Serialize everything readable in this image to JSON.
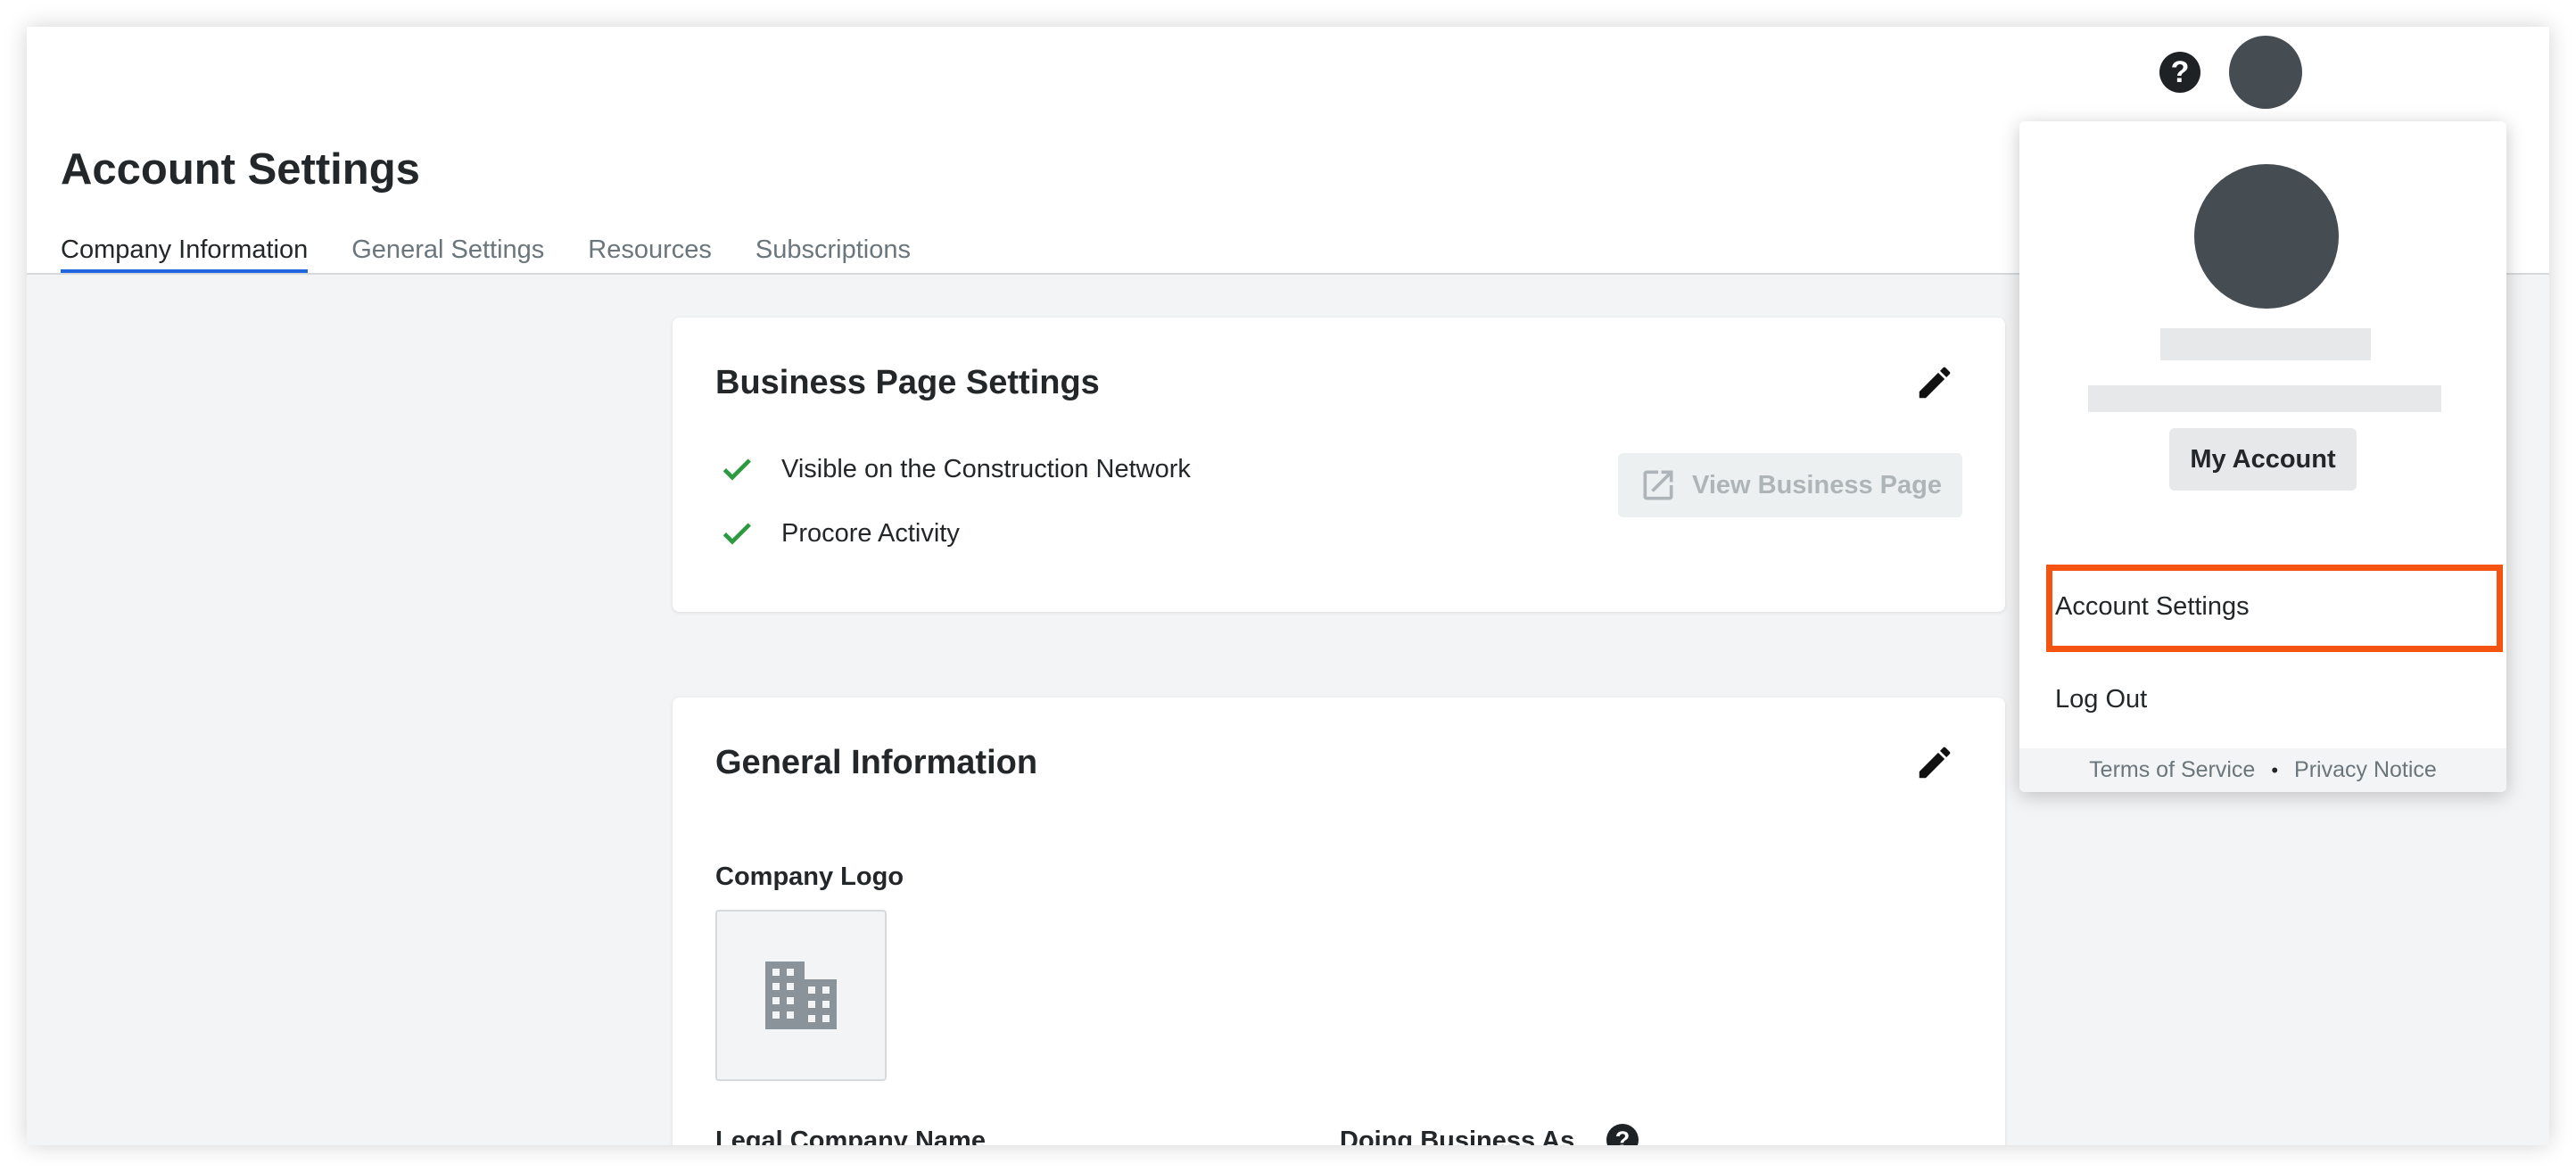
{
  "header": {
    "help_glyph": "?",
    "avatar": "user-avatar"
  },
  "page": {
    "title": "Account Settings",
    "tabs": [
      {
        "label": "Company Information",
        "active": true
      },
      {
        "label": "General Settings",
        "active": false
      },
      {
        "label": "Resources",
        "active": false
      },
      {
        "label": "Subscriptions",
        "active": false
      }
    ]
  },
  "business_card": {
    "title": "Business Page Settings",
    "items": [
      {
        "label": "Visible on the Construction Network",
        "icon": "check-icon"
      },
      {
        "label": "Procore Activity",
        "icon": "check-icon"
      }
    ],
    "view_button": "View Business Page"
  },
  "general_card": {
    "title": "General Information",
    "logo_label": "Company Logo",
    "legal_name_label": "Legal Company Name",
    "dba_label": "Doing Business As",
    "help_glyph": "?"
  },
  "dropdown": {
    "my_account": "My Account",
    "items": [
      {
        "label": "Account Settings",
        "selected": true
      },
      {
        "label": "Log Out",
        "selected": false
      }
    ],
    "footer": {
      "terms": "Terms of Service",
      "separator": "•",
      "privacy": "Privacy Notice"
    }
  },
  "colors": {
    "accent_tab": "#2066df",
    "check_green": "#2b9a41",
    "highlight": "#f55312",
    "avatar": "#454c52"
  }
}
